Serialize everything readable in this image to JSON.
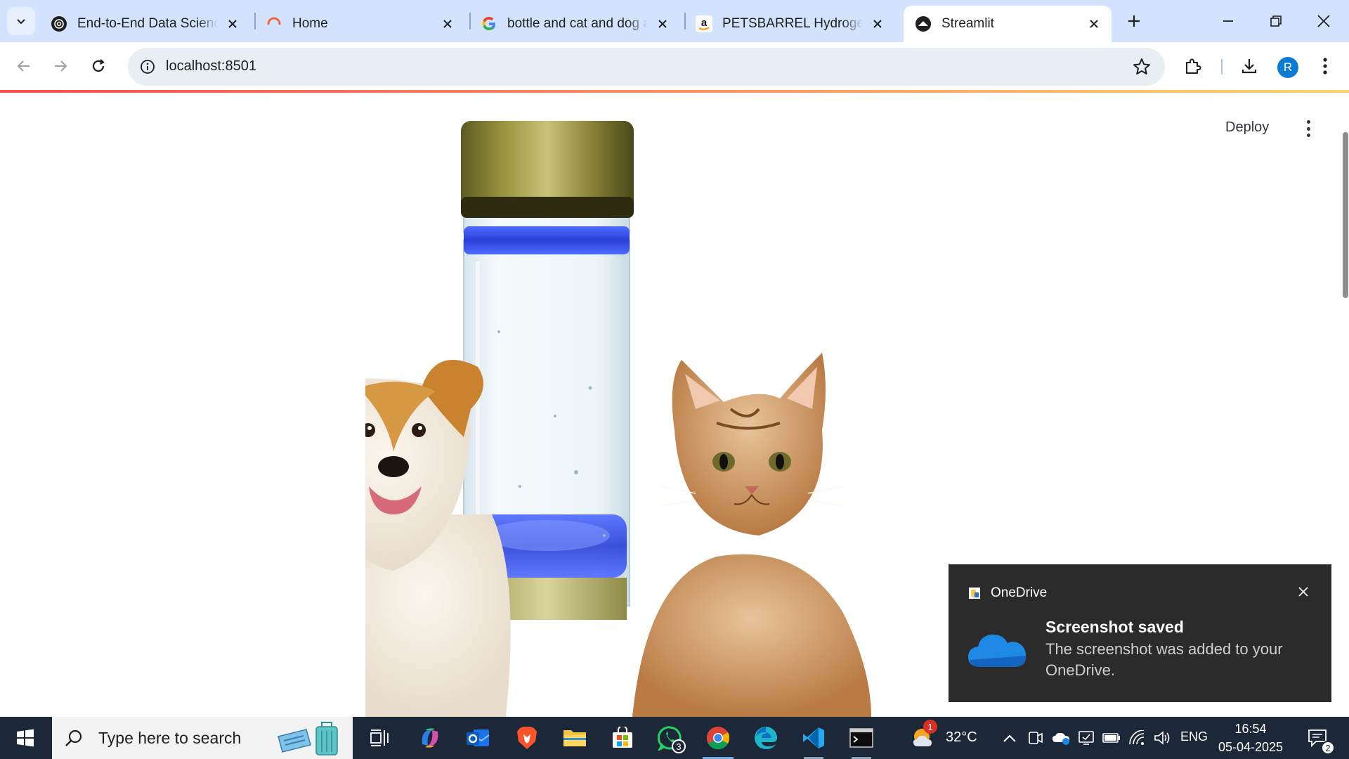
{
  "browser": {
    "tabs": [
      {
        "title": "End-to-End Data Science",
        "favicon": "openai-icon",
        "active": false
      },
      {
        "title": "Home",
        "favicon": "loading-spinner-icon",
        "active": false
      },
      {
        "title": "bottle and cat and dog an",
        "favicon": "google-icon",
        "active": false
      },
      {
        "title": "PETSBARREL Hydrogen W",
        "favicon": "amazon-icon",
        "active": false
      },
      {
        "title": "Streamlit",
        "favicon": "streamlit-icon",
        "active": true
      }
    ],
    "url": "localhost:8501",
    "profile_initial": "R"
  },
  "app": {
    "deploy_label": "Deploy",
    "image_subject": "water bottle with dog and cat",
    "colors": {
      "accent_red": "#ff4b4b",
      "accent_yellow": "#ffd36b"
    }
  },
  "notification": {
    "app_name": "OneDrive",
    "heading": "Screenshot saved",
    "body": "The screenshot was added to your OneDrive."
  },
  "taskbar": {
    "search_placeholder": "Type here to search",
    "whatsapp_badge": "3",
    "weather_badge": "1",
    "temperature": "32°C",
    "language": "ENG",
    "time": "16:54",
    "date": "05-04-2025",
    "notification_count": "2"
  }
}
